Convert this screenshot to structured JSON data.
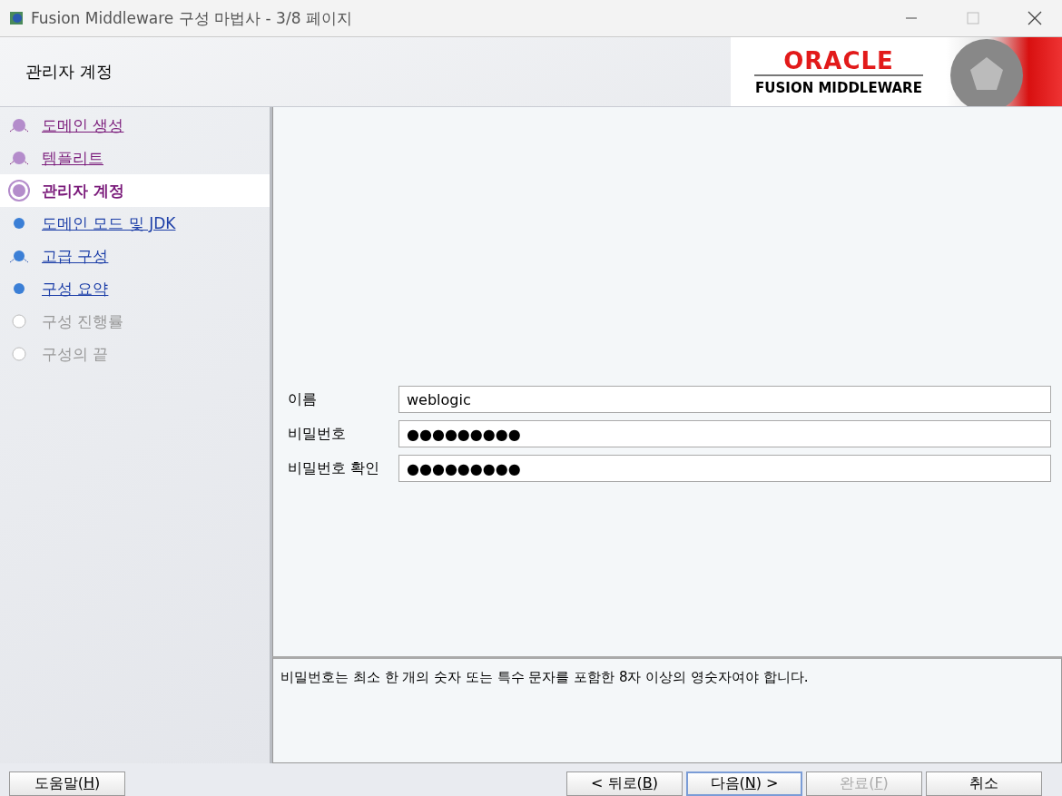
{
  "window": {
    "title": "Fusion Middleware 구성 마법사 - 3/8 페이지"
  },
  "header": {
    "title": "관리자 계정",
    "logo_brand": "ORACLE",
    "logo_product": "FUSION MIDDLEWARE"
  },
  "steps": [
    {
      "label": "도메인 생성",
      "kind": "visited",
      "fork": true,
      "selected": false
    },
    {
      "label": "템플리트",
      "kind": "visited",
      "fork": true,
      "selected": false
    },
    {
      "label": "관리자 계정",
      "kind": "current",
      "fork": false,
      "selected": true
    },
    {
      "label": "도메인 모드 및 JDK",
      "kind": "link",
      "fork": false,
      "selected": false
    },
    {
      "label": "고급 구성",
      "kind": "link",
      "fork": true,
      "selected": false
    },
    {
      "label": "구성 요약",
      "kind": "link",
      "fork": false,
      "selected": false
    },
    {
      "label": "구성 진행률",
      "kind": "disabled",
      "fork": false,
      "selected": false
    },
    {
      "label": "구성의 끝",
      "kind": "disabled",
      "fork": false,
      "selected": false
    }
  ],
  "form": [
    {
      "label": "이름",
      "value": "weblogic"
    },
    {
      "label": "비밀번호",
      "value": "●●●●●●●●●"
    },
    {
      "label": "비밀번호 확인",
      "value": "●●●●●●●●●"
    }
  ],
  "message": "비밀번호는 최소 한 개의 숫자 또는 특수 문자를 포함한 8자 이상의 영숫자여야 합니다.",
  "help_button": {
    "before": "도움말(",
    "key": "H",
    "after": ")",
    "disabled": false,
    "focused": false
  },
  "buttons": [
    {
      "before": "< 뒤로(",
      "key": "B",
      "after": ")",
      "disabled": false,
      "focused": false
    },
    {
      "before": "다음(",
      "key": "N",
      "after": ") >",
      "disabled": false,
      "focused": true
    },
    {
      "before": "완료(",
      "key": "F",
      "after": ")",
      "disabled": true,
      "focused": false
    },
    {
      "before": "취소",
      "disabled": false,
      "focused": false
    }
  ]
}
